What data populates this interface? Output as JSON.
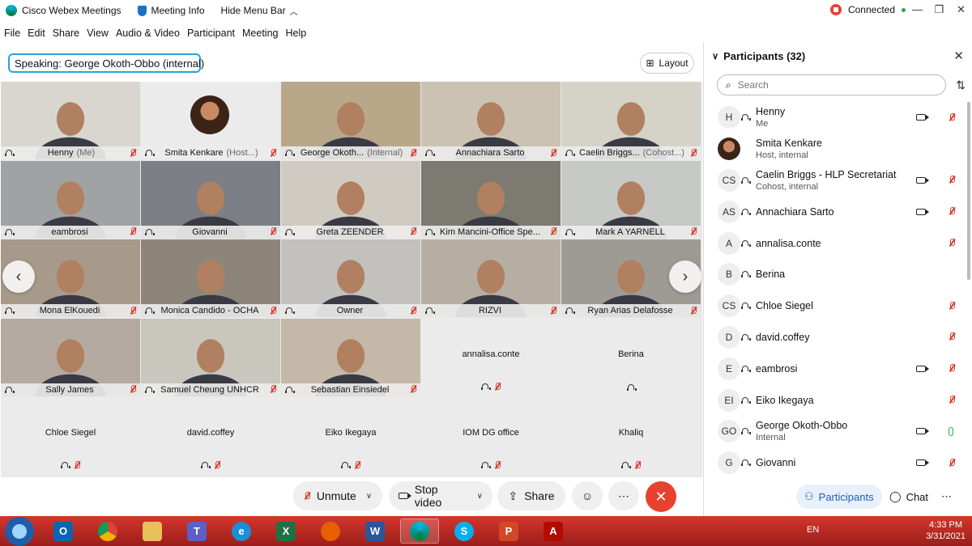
{
  "titlebar": {
    "app": "Cisco Webex Meetings",
    "meeting_info": "Meeting Info",
    "hide_menu": "Hide Menu Bar",
    "status": "Connected",
    "win_min": "—",
    "win_max": "❐",
    "win_close": "✕"
  },
  "menu": [
    "File",
    "Edit",
    "Share",
    "View",
    "Audio & Video",
    "Participant",
    "Meeting",
    "Help"
  ],
  "speaking": {
    "label": "Speaking:",
    "name": "George Okoth-Obbo (internal)"
  },
  "layout_label": "Layout",
  "tiles": [
    {
      "name": "Henny",
      "sub": "(Me)",
      "video": true,
      "c": "#d9d6cf"
    },
    {
      "name": "Smita Kenkare",
      "sub": "(Host...)",
      "video": false,
      "avatar": true
    },
    {
      "name": "George Okoth...",
      "sub": "(Internal)",
      "video": true,
      "c": "#b9a78a",
      "active": true
    },
    {
      "name": "Annachiara Sarto",
      "sub": "",
      "video": true,
      "c": "#cbc2b3"
    },
    {
      "name": "Caelin Briggs...",
      "sub": "(Cohost...)",
      "video": true,
      "c": "#d5d2c8"
    },
    {
      "name": "eambrosi",
      "sub": "",
      "video": true,
      "c": "#9fa3a3"
    },
    {
      "name": "Giovanni",
      "sub": "",
      "video": true,
      "c": "#7c7f86"
    },
    {
      "name": "Greta ZEENDER",
      "sub": "",
      "video": true,
      "c": "#d0cbc2"
    },
    {
      "name": "Kim Mancini-Office Spe...",
      "sub": "",
      "video": true,
      "c": "#7d7a72"
    },
    {
      "name": "Mark A YARNELL",
      "sub": "",
      "video": true,
      "c": "#c7c9c6"
    },
    {
      "name": "Mona ElKouedi",
      "sub": "",
      "video": true,
      "c": "#a79a8a"
    },
    {
      "name": "Monica Candido - OCHA",
      "sub": "",
      "video": true,
      "c": "#8d857a"
    },
    {
      "name": "Owner",
      "sub": "",
      "video": true,
      "c": "#c2c1bd"
    },
    {
      "name": "RIZVI",
      "sub": "",
      "video": true,
      "c": "#b6aea3"
    },
    {
      "name": "Ryan Arias Delafosse",
      "sub": "",
      "video": true,
      "c": "#9e9a94"
    },
    {
      "name": "Sally James",
      "sub": "",
      "video": true,
      "c": "#b5aaa1"
    },
    {
      "name": "Samuel Cheung UNHCR",
      "sub": "",
      "video": true,
      "c": "#c9c6bd"
    },
    {
      "name": "Sebastian Einsiedel",
      "sub": "",
      "video": true,
      "c": "#c4b9a8"
    },
    {
      "name": "annalisa.conte",
      "sub": "",
      "video": false
    },
    {
      "name": "Berina",
      "sub": "",
      "video": false,
      "nomic": true
    },
    {
      "name": "Chloe Siegel",
      "sub": "",
      "video": false
    },
    {
      "name": "david.coffey",
      "sub": "",
      "video": false
    },
    {
      "name": "Eiko Ikegaya",
      "sub": "",
      "video": false
    },
    {
      "name": "IOM DG office",
      "sub": "",
      "video": false
    },
    {
      "name": "Khaliq",
      "sub": "",
      "video": false
    }
  ],
  "panel": {
    "title": "Participants (32)",
    "search_placeholder": "Search",
    "participants": [
      {
        "initials": "H",
        "name": "Henny",
        "role": "Me",
        "cam": true,
        "mic": "muted"
      },
      {
        "initials": "",
        "name": "Smita Kenkare",
        "role": "Host, internal",
        "cam": false,
        "mic": "none",
        "photo": true
      },
      {
        "initials": "CS",
        "name": "Caelin Briggs - HLP Secretariat",
        "role": "Cohost, internal",
        "cam": true,
        "mic": "muted"
      },
      {
        "initials": "AS",
        "name": "Annachiara Sarto",
        "role": "",
        "cam": true,
        "mic": "muted"
      },
      {
        "initials": "A",
        "name": "annalisa.conte",
        "role": "",
        "cam": false,
        "mic": "muted"
      },
      {
        "initials": "B",
        "name": "Berina",
        "role": "",
        "cam": false,
        "mic": "none"
      },
      {
        "initials": "CS",
        "name": "Chloe Siegel",
        "role": "",
        "cam": false,
        "mic": "muted"
      },
      {
        "initials": "D",
        "name": "david.coffey",
        "role": "",
        "cam": false,
        "mic": "muted"
      },
      {
        "initials": "E",
        "name": "eambrosi",
        "role": "",
        "cam": true,
        "mic": "muted"
      },
      {
        "initials": "EI",
        "name": "Eiko Ikegaya",
        "role": "",
        "cam": false,
        "mic": "muted"
      },
      {
        "initials": "GO",
        "name": "George Okoth-Obbo",
        "role": "Internal",
        "cam": true,
        "mic": "on"
      },
      {
        "initials": "G",
        "name": "Giovanni",
        "role": "",
        "cam": true,
        "mic": "muted"
      }
    ]
  },
  "controls": {
    "unmute": "Unmute",
    "stop_video": "Stop video",
    "share": "Share",
    "participants": "Participants",
    "chat": "Chat"
  },
  "taskbar": {
    "lang": "EN",
    "time": "4:33 PM",
    "date": "3/31/2021"
  }
}
